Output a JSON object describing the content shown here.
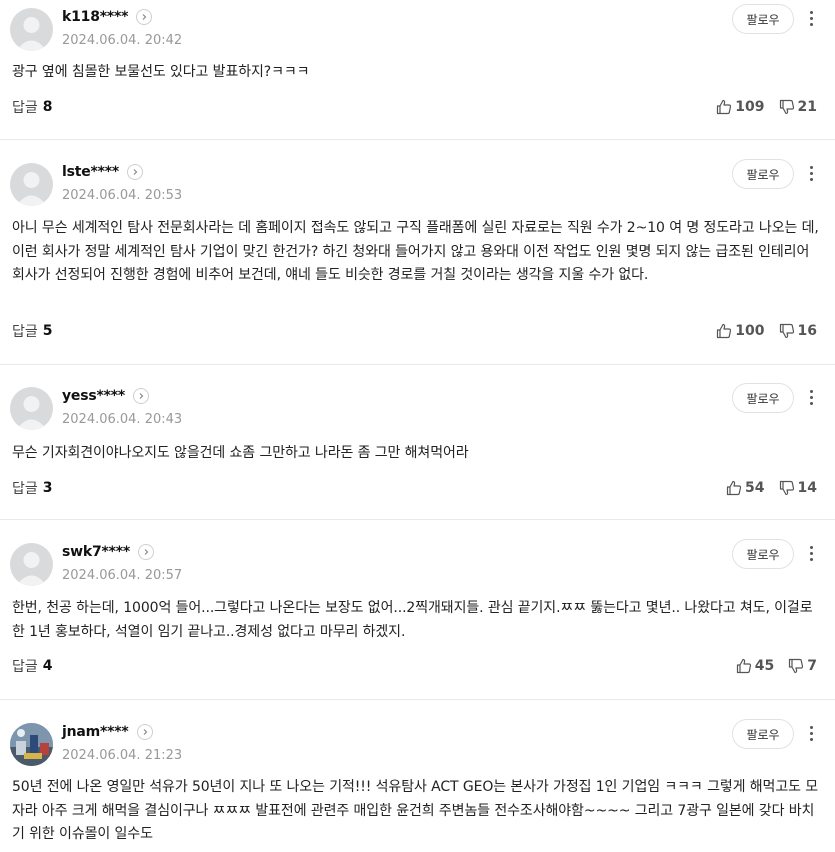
{
  "follow_label": "팔로우",
  "reply_label": "답글",
  "comments": [
    {
      "nickname": "k118****",
      "date": "2024.06.04. 20:42",
      "body": "광구 옆에 침몰한 보물선도 있다고 발표하지?ㅋㅋㅋ",
      "replies": "8",
      "likes": "109",
      "dislikes": "21"
    },
    {
      "nickname": "lste****",
      "date": "2024.06.04. 20:53",
      "body": "아니 무슨 세계적인 탐사 전문회사라는 데 홈페이지 접속도 않되고 구직 플래폼에 실린 자료로는 직원 수가 2~10 여 명 정도라고 나오는 데, 이런 회사가 정말 세계적인 탐사 기업이 맞긴 한건가? 하긴 청와대 들어가지 않고 용와대 이전 작업도 인원 몇명 되지 않는 급조된 인테리어 회사가 선정되어 진행한 경험에 비추어 보건데, 얘네 들도 비슷한 경로를 거칠 것이라는 생각을 지울 수가 없다.",
      "replies": "5",
      "likes": "100",
      "dislikes": "16"
    },
    {
      "nickname": "yess****",
      "date": "2024.06.04. 20:43",
      "body": "무슨 기자회견이야나오지도 않을건데 쇼좀 그만하고 나라돈 좀 그만 해쳐먹어라",
      "replies": "3",
      "likes": "54",
      "dislikes": "14"
    },
    {
      "nickname": "swk7****",
      "date": "2024.06.04. 20:57",
      "body": "한번, 천공 하는데, 1000억 들어...그렇다고 나온다는 보장도 없어...2찍개돼지들. 관심 끝기지.ㅉㅉ 뚫는다고 몇년.. 나왔다고 쳐도, 이걸로 한 1년 홍보하다, 석열이 임기 끝나고..경제성 없다고 마무리 하겠지.",
      "replies": "4",
      "likes": "45",
      "dislikes": "7"
    },
    {
      "nickname": "jnam****",
      "date": "2024.06.04. 21:23",
      "body": "50년 전에 나온 영일만 석유가 50년이 지나 또 나오는 기적!!! 석유탐사 ACT GEO는 본사가 가정집 1인 기업임 ㅋㅋㅋ 그렇게 해먹고도 모자라 아주 크게 해먹을 결심이구나 ㅉㅉㅉ 발표전에 관련주 매입한 윤건희 주변놈들 전수조사해야함~~~~ 그리고 7광구 일본에 갖다 바치기 위한 이슈몰이 일수도"
    }
  ]
}
